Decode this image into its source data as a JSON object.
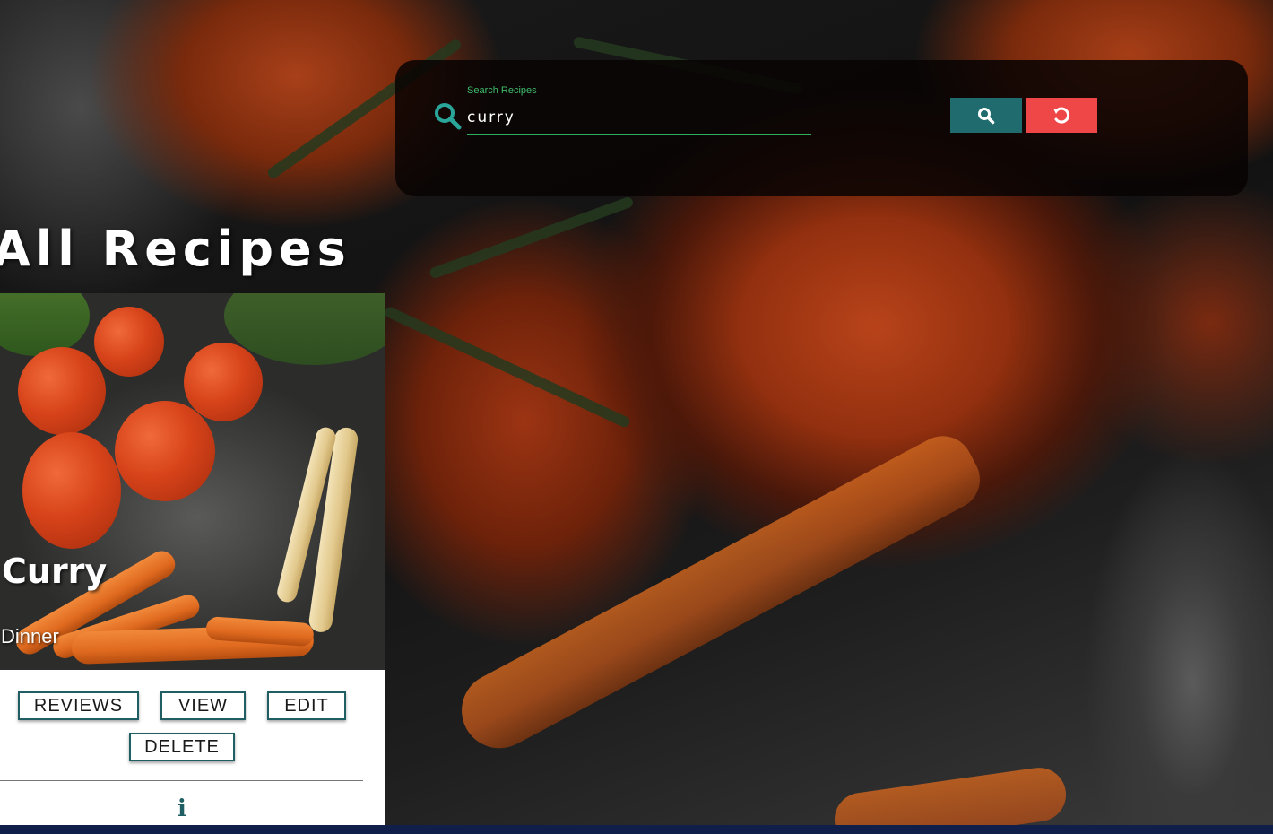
{
  "search": {
    "label": "Search Recipes",
    "value": "curry",
    "icon": "search-icon"
  },
  "buttons": {
    "search_icon": "search-icon",
    "reset_icon": "reset-icon"
  },
  "colors": {
    "accent_teal": "#1f6b6d",
    "reset_red": "#ef4747",
    "label_green": "#3fbf6a"
  },
  "page": {
    "title": "All Recipes"
  },
  "recipe_card": {
    "title": "Curry",
    "category": "Dinner",
    "actions": {
      "reviews": "REVIEWS",
      "view": "VIEW",
      "edit": "EDIT",
      "delete": "DELETE"
    },
    "info_icon": "info-icon"
  }
}
